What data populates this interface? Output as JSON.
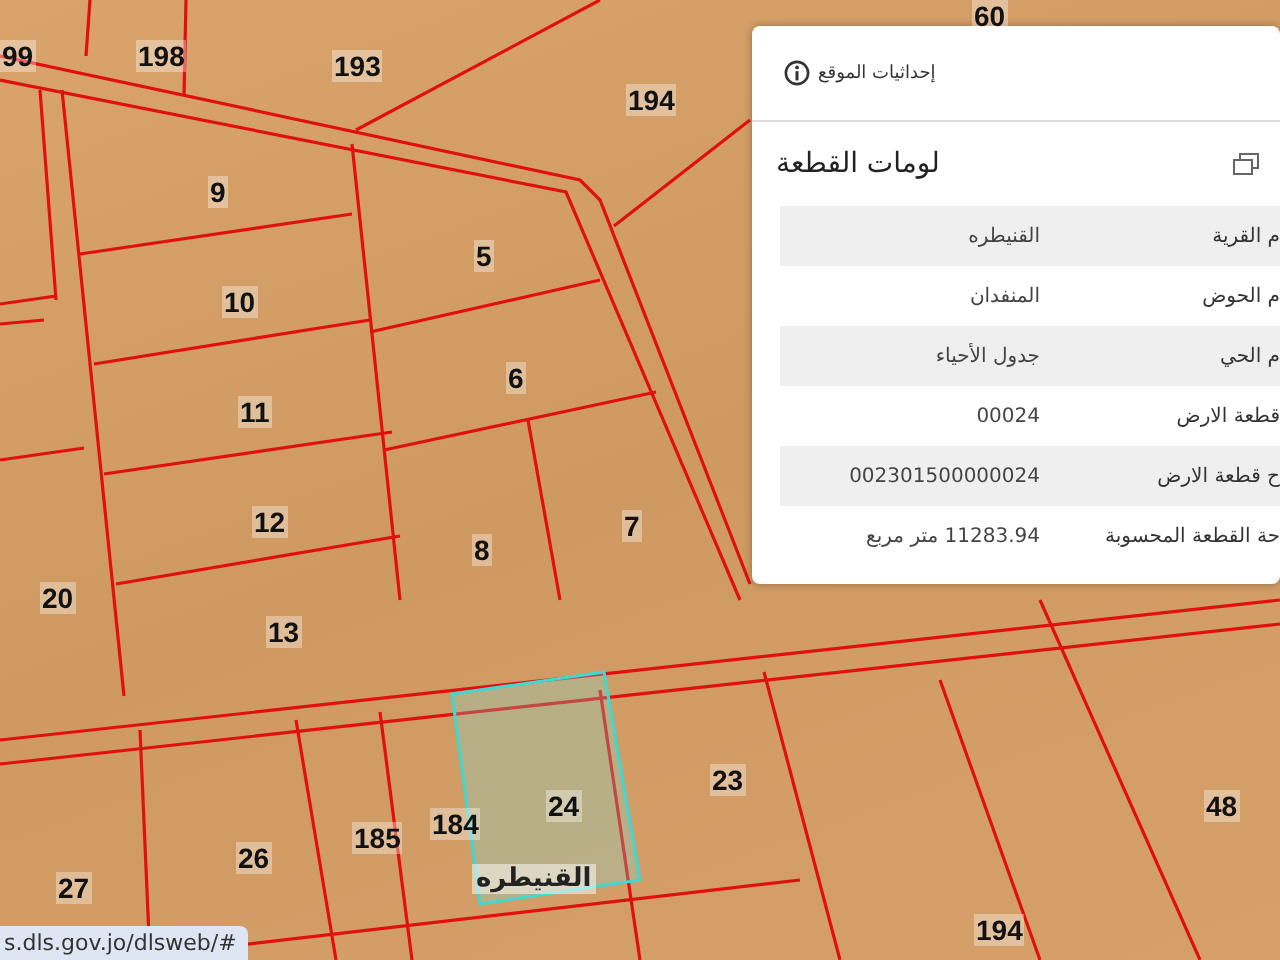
{
  "map": {
    "parcels": [
      {
        "label": "60"
      },
      {
        "label": "198"
      },
      {
        "label": "99"
      },
      {
        "label": "193"
      },
      {
        "label": "194"
      },
      {
        "label": "9"
      },
      {
        "label": "5"
      },
      {
        "label": "10"
      },
      {
        "label": "6"
      },
      {
        "label": "11"
      },
      {
        "label": "12"
      },
      {
        "label": "7"
      },
      {
        "label": "8"
      },
      {
        "label": "20"
      },
      {
        "label": "13"
      },
      {
        "label": "23"
      },
      {
        "label": "48"
      },
      {
        "label": "24"
      },
      {
        "label": "184"
      },
      {
        "label": "185"
      },
      {
        "label": "26"
      },
      {
        "label": "27"
      },
      {
        "label": "194"
      }
    ],
    "place_name": "القنيطره",
    "url": "s.dls.gov.jo/dlsweb/#"
  },
  "panel": {
    "coordinates_link": "إحداثيات الموقع",
    "title": "لومات القطعة",
    "rows": [
      {
        "label": "م القرية",
        "value": "القنيطره"
      },
      {
        "label": "م الحوض",
        "value": "المنفدان"
      },
      {
        "label": "م الحي",
        "value": "جدول الأحياء"
      },
      {
        "label": "قطعة الارض",
        "value": "00024"
      },
      {
        "label": "ح قطعة الارض",
        "value": "002301500000024"
      },
      {
        "label": "حة القطعة المحسوبة",
        "value": "11283.94 متر مربع"
      }
    ]
  }
}
